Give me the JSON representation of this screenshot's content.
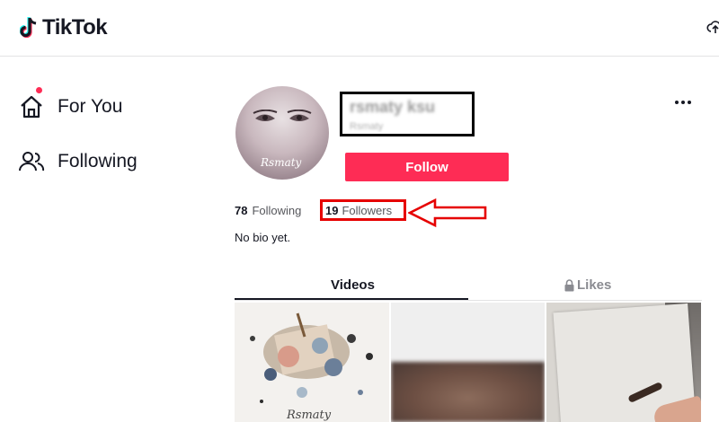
{
  "header": {
    "logo_text": "TikTok",
    "icons": [
      "tiktok-logo-icon",
      "upload-cloud-icon"
    ]
  },
  "sidebar": {
    "items": [
      {
        "label": "For You",
        "icon": "home-icon",
        "has_notification_dot": true
      },
      {
        "label": "Following",
        "icon": "users-icon"
      }
    ]
  },
  "profile": {
    "follow_label": "Follow",
    "following_count": "78",
    "following_label": "Following",
    "followers_count": "19",
    "followers_label": "Followers",
    "bio": "No bio yet.",
    "avatar_signature": "Rsmaty"
  },
  "tabs": [
    {
      "label": "Videos",
      "active": true
    },
    {
      "label": "Likes",
      "active": false,
      "icon": "lock-icon"
    }
  ],
  "videos": [
    {
      "signature": "Rsmaty"
    },
    {},
    {}
  ],
  "colors": {
    "accent": "#fe2c55",
    "text": "#161823",
    "annotation": "#e60000"
  }
}
